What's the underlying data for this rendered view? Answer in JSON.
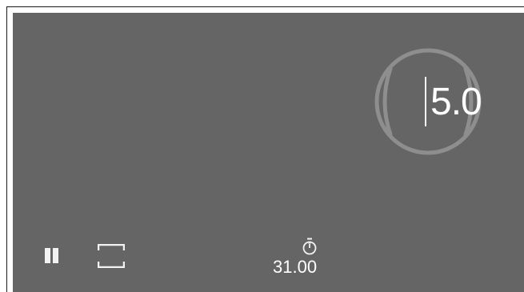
{
  "dial": {
    "value": "5.0",
    "icon": "dial-knob"
  },
  "controls": {
    "pause_icon": "pause-icon",
    "fullscreen_icon": "fullscreen-icon"
  },
  "timer": {
    "icon": "stopwatch-icon",
    "value": "31.00"
  },
  "colors": {
    "panel": "#656565",
    "foreground": "#ffffff",
    "dial_ring": "#8c8c8c"
  }
}
